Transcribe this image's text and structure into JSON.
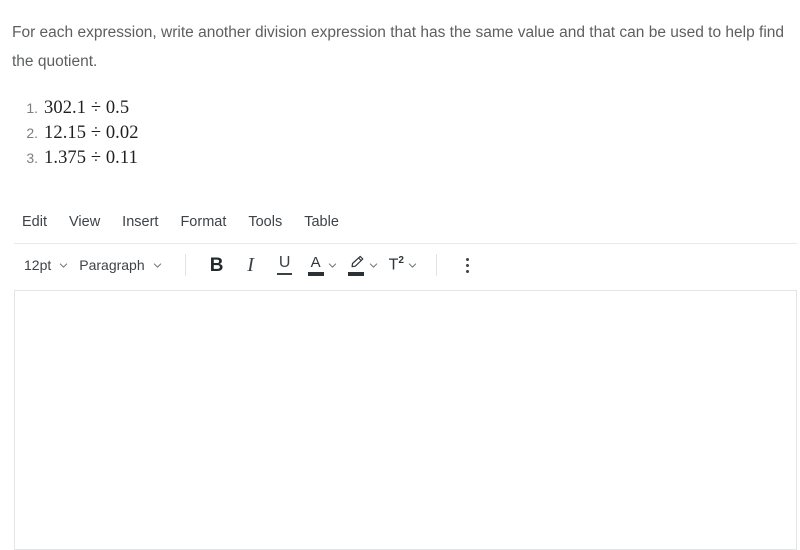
{
  "prompt": {
    "text": "For each expression, write another division expression that has the same value and that can be used to help find the quotient."
  },
  "expressions": [
    {
      "marker": "1.",
      "text": "302.1 ÷ 0.5"
    },
    {
      "marker": "2.",
      "text": "12.15 ÷ 0.02"
    },
    {
      "marker": "3.",
      "text": "1.375 ÷ 0.11"
    }
  ],
  "editor": {
    "menubar": [
      {
        "label": "Edit"
      },
      {
        "label": "View"
      },
      {
        "label": "Insert"
      },
      {
        "label": "Format"
      },
      {
        "label": "Tools"
      },
      {
        "label": "Table"
      }
    ],
    "toolbar": {
      "font_size": "12pt",
      "block_format": "Paragraph",
      "bold_label": "B",
      "italic_label": "I",
      "underline_label": "U",
      "text_color_label": "A",
      "superscript_label": "T",
      "superscript_exponent": "2"
    },
    "content": {
      "value": "",
      "placeholder": ""
    }
  },
  "colors": {
    "prompt_text": "#5c5f61",
    "expression_text": "#1d1f20",
    "marker_text": "#7b7f82",
    "menu_text": "#3d4347",
    "icon": "#2f3538",
    "border": "#e3e4e5",
    "divider": "#e9e9ea",
    "background": "#ffffff"
  }
}
